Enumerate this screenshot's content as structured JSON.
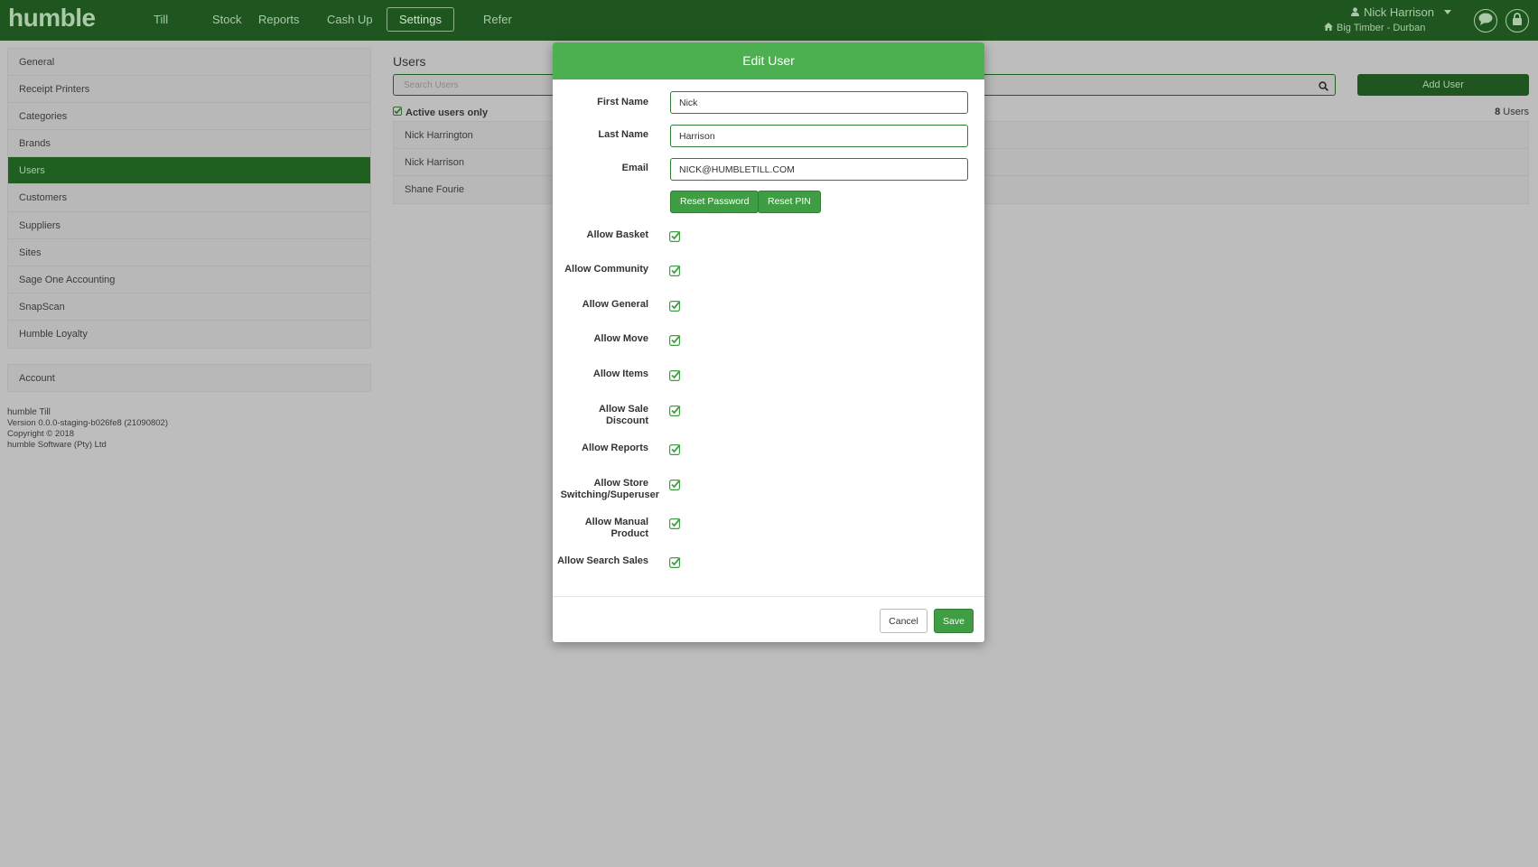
{
  "nav": {
    "logo": "humble",
    "items": [
      {
        "label": "Till"
      },
      {
        "label": "Stock"
      },
      {
        "label": "Reports"
      },
      {
        "label": "Cash Up"
      },
      {
        "label": "Settings",
        "active": true
      },
      {
        "label": "Refer"
      }
    ],
    "user_name": "Nick Harrison",
    "site_name": "Big Timber - Durban",
    "icons": [
      "user-icon",
      "home-icon",
      "chat-icon",
      "lock-icon"
    ]
  },
  "sidebar": {
    "items": [
      {
        "label": "General"
      },
      {
        "label": "Receipt Printers"
      },
      {
        "label": "Categories"
      },
      {
        "label": "Brands"
      },
      {
        "label": "Users",
        "active": true
      },
      {
        "label": "Customers"
      },
      {
        "label": "Suppliers"
      },
      {
        "label": "Sites"
      },
      {
        "label": "Sage One Accounting"
      },
      {
        "label": "SnapScan"
      },
      {
        "label": "Humble Loyalty"
      }
    ],
    "account_label": "Account"
  },
  "version_info": {
    "app": "humble Till",
    "version": "Version 0.0.0-staging-b026fe8 (21090802)",
    "copyright": "Copyright © 2018",
    "company": "humble Software (Pty) Ltd"
  },
  "users": {
    "title": "Users",
    "search_placeholder": "Search Users",
    "add_button": "Add User",
    "active_only_label": "Active users only",
    "count": "8",
    "count_suffix": "Users",
    "list": [
      "Nick Harrington",
      "Nick Harrison",
      "Shane Fourie"
    ]
  },
  "modal": {
    "title": "Edit User",
    "first_name_label": "First Name",
    "first_name_value": "Nick",
    "last_name_label": "Last Name",
    "last_name_value": "Harrison",
    "email_label": "Email",
    "email_value": "NICK@HUMBLETILL.COM",
    "reset_password": "Reset Password",
    "reset_pin": "Reset PIN",
    "permissions": [
      {
        "line1": "Allow Basket",
        "line2": "",
        "checked": true
      },
      {
        "line1": "Allow Community",
        "line2": "",
        "checked": true
      },
      {
        "line1": "Allow General",
        "line2": "",
        "checked": true
      },
      {
        "line1": "Allow Move",
        "line2": "",
        "checked": true
      },
      {
        "line1": "Allow Items",
        "line2": "",
        "checked": true
      },
      {
        "line1": "Allow Sale",
        "line2": "Discount",
        "checked": true
      },
      {
        "line1": "Allow Reports",
        "line2": "",
        "checked": true
      },
      {
        "line1": "Allow Store",
        "line2": "Switching/Superuser",
        "checked": true
      },
      {
        "line1": "Allow Manual",
        "line2": "Product",
        "checked": true
      },
      {
        "line1": "Allow Search Sales",
        "line2": "",
        "checked": true
      }
    ],
    "cancel": "Cancel",
    "save": "Save"
  },
  "colors": {
    "nav_bg": "#1f561f",
    "modal_header": "#4caf50",
    "button_green": "#3f9e43",
    "overlay": "#bdbdbd"
  }
}
